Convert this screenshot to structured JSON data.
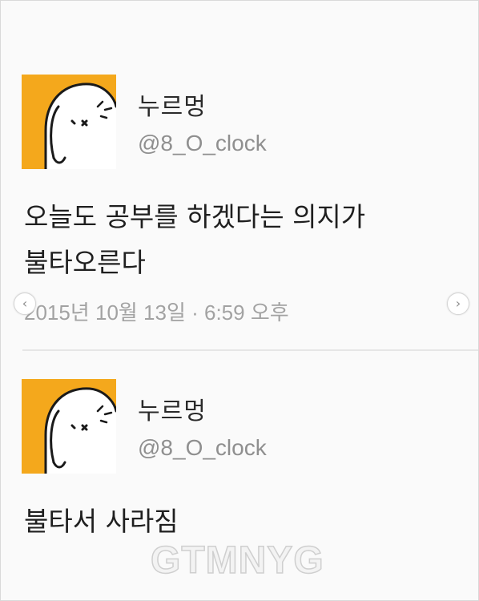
{
  "tweets": [
    {
      "author": {
        "name": "누르멍",
        "handle": "@8_O_clock",
        "avatar_color": "#f4a81c"
      },
      "text": "오늘도 공부를 하겠다는 의지가\n불타오른다",
      "timestamp": "2015년 10월 13일 · 6:59 오후"
    },
    {
      "author": {
        "name": "누르멍",
        "handle": "@8_O_clock",
        "avatar_color": "#f4a81c"
      },
      "text": "불타서 사라짐"
    }
  ],
  "carousel": {
    "prev_icon": "‹",
    "next_icon": "›"
  },
  "watermark": "GTMNYG"
}
